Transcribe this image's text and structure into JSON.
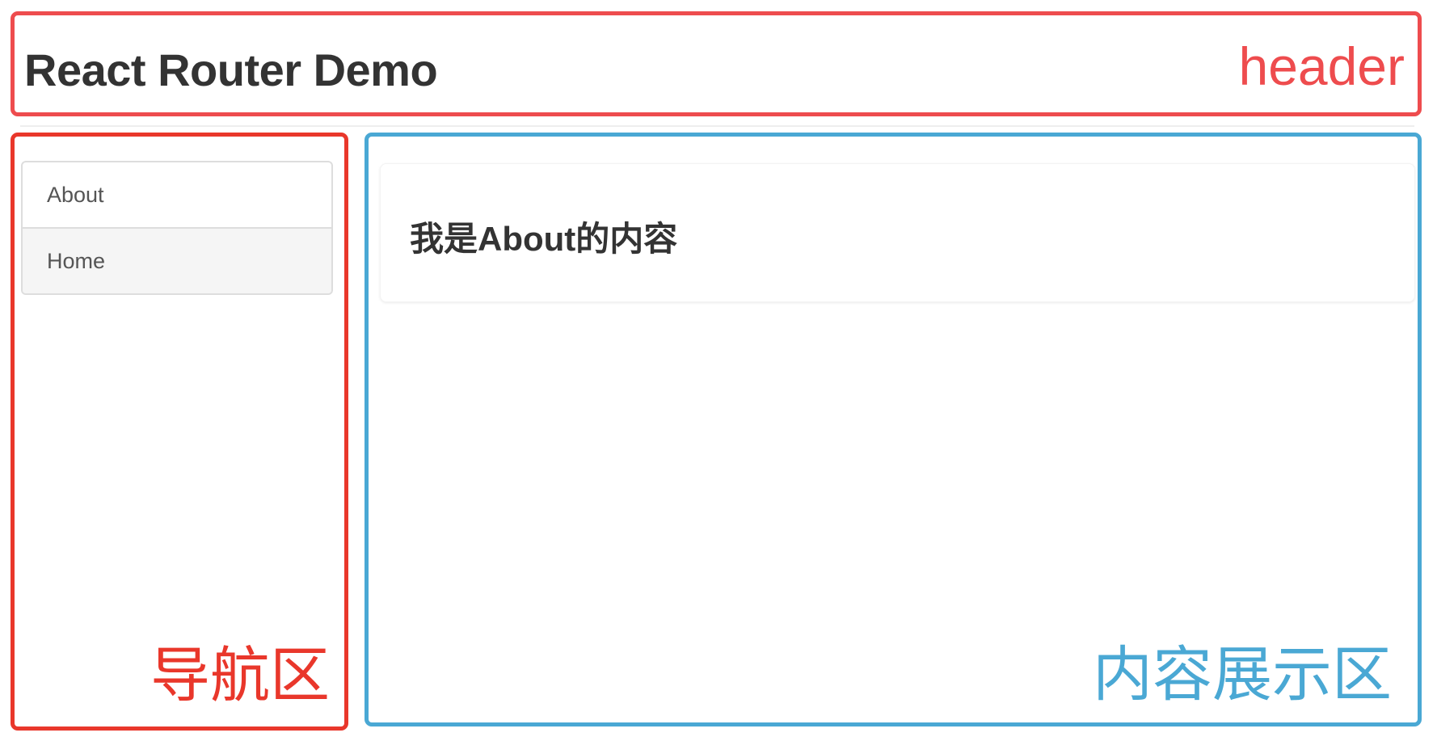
{
  "header": {
    "title": "React Router Demo",
    "annotation_label": "header",
    "annotation_color": "#ee4c4e"
  },
  "nav": {
    "items": [
      {
        "label": "About",
        "active": true
      },
      {
        "label": "Home",
        "active": false
      }
    ],
    "annotation_label": "导航区",
    "annotation_color": "#e9372b"
  },
  "content": {
    "panel_text": "我是About的内容",
    "annotation_label": "内容展示区",
    "annotation_color": "#4aa8d4"
  }
}
